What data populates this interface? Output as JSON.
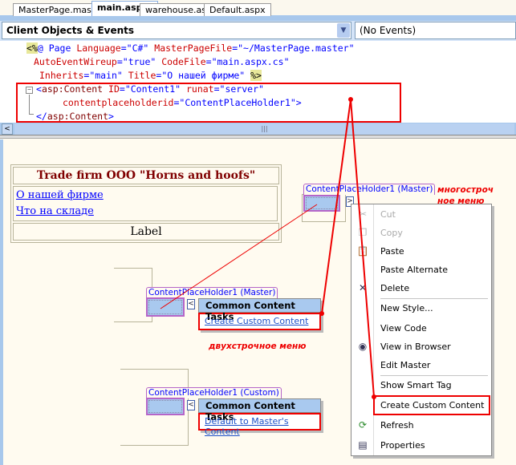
{
  "tabs": [
    {
      "label": "MasterPage.master*"
    },
    {
      "label": "main.aspx*"
    },
    {
      "label": "warehouse.aspx"
    },
    {
      "label": "Default.aspx"
    }
  ],
  "toolbar": {
    "objects_combo": "Client Objects & Events",
    "events_combo": "(No Events)"
  },
  "code": {
    "l1": {
      "open": "<%",
      "at": "@ Page ",
      "a1": "Language",
      "eq1": "=\"C#\" ",
      "a2": "MasterPageFile",
      "eq2": "=\"~/MasterPage.master\""
    },
    "l2": {
      "a1": "AutoEventWireup",
      "eq1": "=\"true\" ",
      "a2": "CodeFile",
      "eq2": "=\"main.aspx.cs\""
    },
    "l3": {
      "a1": "Inherits",
      "eq1": "=\"main\" ",
      "a2": "Title",
      "eq2": "=\"О нашей фирме\" ",
      "close": "%>"
    },
    "l4": {
      "tag_open": "<",
      "tag": "asp:Content",
      "a1": " ID",
      "eq1": "=\"Content1\" ",
      "a2": "runat",
      "eq2": "=\"server\""
    },
    "l5": {
      "a1": "contentplaceholderid",
      "eq1": "=\"ContentPlaceHolder1\">"
    },
    "l6": {
      "tag_open": "</",
      "tag": "asp:Content",
      "tag_close": ">"
    }
  },
  "design": {
    "title": "Trade firm OOO \"Horns and hoofs\"",
    "links": [
      "О нашей фирме",
      "Что на складе"
    ],
    "label": "Label",
    "cph_master_1": "ContentPlaceHolder1 (Master)",
    "cph_master_2": "ContentPlaceHolder1 (Master)",
    "cph_custom": "ContentPlaceHolder1 (Custom)",
    "tasks1": {
      "header": "Common Content Tasks",
      "link": "Create Custom Content"
    },
    "tasks2": {
      "header": "Common Content Tasks",
      "link": "Default to Master's Content"
    },
    "note_multi": "многострочное меню",
    "note_multi_l1": "многостроч",
    "note_multi_l2": "ное меню",
    "note_two": "двухстрочное меню"
  },
  "context_menu": {
    "items": [
      {
        "label": "Cut",
        "icon": "scissors-icon",
        "disabled": true
      },
      {
        "label": "Copy",
        "icon": "copy-icon",
        "disabled": true
      },
      {
        "label": "Paste",
        "icon": "paste-icon"
      },
      {
        "label": "Paste Alternate"
      },
      {
        "label": "Delete",
        "icon": "delete-x-icon"
      },
      {
        "label": "New Style..."
      },
      {
        "label": "View Code"
      },
      {
        "label": "View in Browser",
        "icon": "browser-icon"
      },
      {
        "label": "Edit Master"
      },
      {
        "label": "Show Smart Tag"
      },
      {
        "label": "Create Custom Content",
        "highlighted": true
      },
      {
        "label": "Refresh",
        "icon": "refresh-icon"
      },
      {
        "label": "Properties",
        "icon": "properties-icon"
      }
    ]
  },
  "colors": {
    "accent": "#a8c8ec",
    "annotation": "#ee0000",
    "placeholder_border": "#b565c8"
  }
}
